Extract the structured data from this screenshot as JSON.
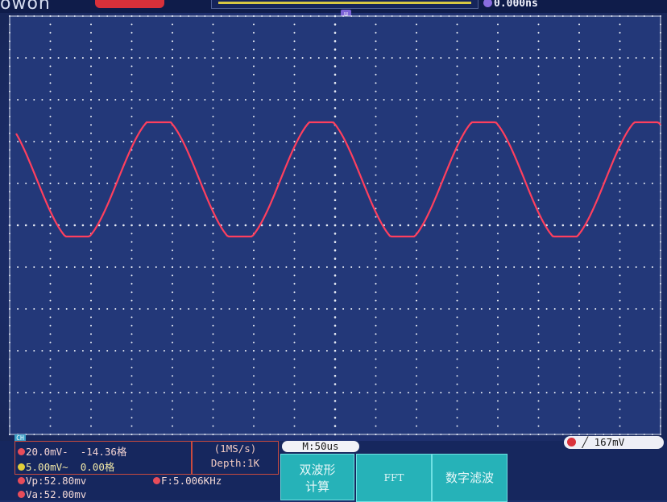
{
  "brand": "owon",
  "horizontal_position": "0.000ns",
  "channel_marker": "CH",
  "channel1": {
    "volts_div": "20.0mV",
    "coupling": "-",
    "offset": "-14.36格",
    "color": "#e84c5a"
  },
  "channel2": {
    "volts_div": "5.00mV",
    "coupling": "~",
    "offset": "0.00格",
    "color": "#e3cf3a"
  },
  "acquisition": {
    "sample_rate": "(1MS/s)",
    "depth": "Depth:1K"
  },
  "measurements": {
    "vp": "Vp:52.80mv",
    "va": "Va:52.00mv",
    "freq": "F:5.006KHz"
  },
  "timebase": "M:50us",
  "trigger": {
    "level": "167mV",
    "edge": "rising"
  },
  "menu": {
    "dual_wave": [
      "双波形",
      "计算"
    ],
    "fft": "FFT",
    "digital_filter": "数字滤波"
  },
  "waveform": {
    "color": "#ff3f5e",
    "frequency_khz": 5.006,
    "peak_to_peak_mv": 52.8,
    "time_per_div_us": 50
  },
  "colors": {
    "screen_bg": "#223676",
    "grid_dots": "#e8ecf5",
    "menu_bg": "#26b2b8"
  }
}
